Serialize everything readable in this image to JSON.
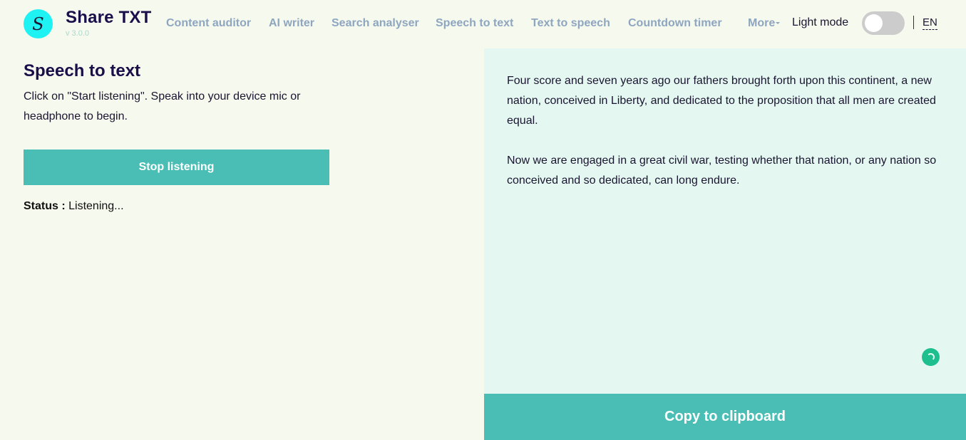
{
  "header": {
    "logo_letter": "S",
    "brand": "Share TXT",
    "version": "v 3.0.0",
    "nav": [
      {
        "label": "Content auditor"
      },
      {
        "label": "AI writer"
      },
      {
        "label": "Search analyser"
      },
      {
        "label": "Speech to text"
      },
      {
        "label": "Text to speech"
      },
      {
        "label": "Countdown timer"
      },
      {
        "label": "More"
      }
    ],
    "theme_label": "Light mode",
    "theme_toggle_on": false,
    "language": "EN"
  },
  "left": {
    "title": "Speech to text",
    "instructions": "Click on \"Start listening\". Speak into your device mic or headphone to begin.",
    "stop_button": "Stop listening",
    "status_label": "Status :",
    "status_value": "Listening..."
  },
  "right": {
    "paragraphs": [
      "Four score and seven years ago our fathers brought forth upon this continent, a new nation, conceived in Liberty, and dedicated to the proposition that all men are created equal.",
      "Now we are engaged in a great civil war, testing whether that nation, or any nation so conceived and so dedicated, can long endure."
    ],
    "copy_button": "Copy to clipboard"
  },
  "colors": {
    "accent": "#4abdb5",
    "logo": "#1ff2f2",
    "nav_text": "#8ea6bf",
    "spinner": "#1dbf8e"
  }
}
